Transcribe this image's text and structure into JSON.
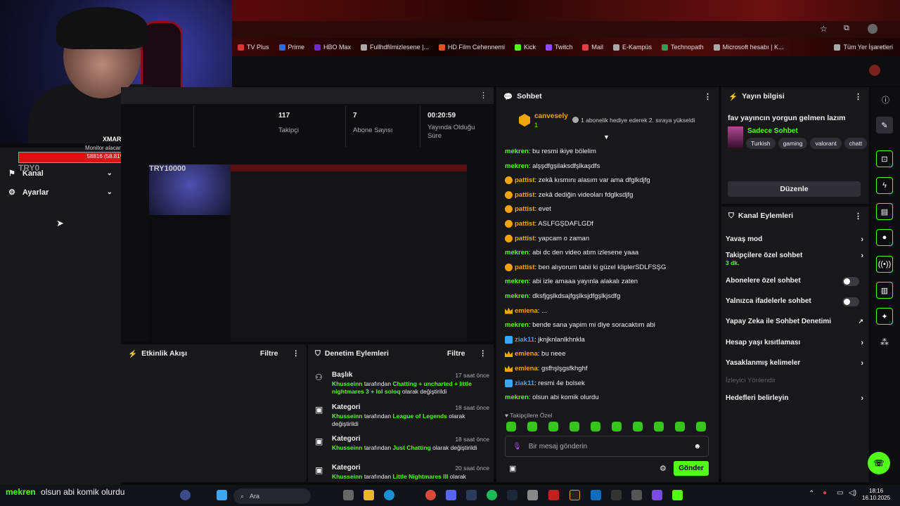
{
  "bookmarks": [
    "TV Plus",
    "Prime",
    "HBO Max",
    "Fullhdfilmizlesene |...",
    "HD Film Cehennemi",
    "Kick",
    "Twitch",
    "Mail",
    "E-Kampüs",
    "Technopath",
    "Microsoft hesabı | K...",
    "Tüm Yer İşaretleri"
  ],
  "overlay": {
    "webcam_name": "XMARD",
    "monitor_label": "Monitor alacam",
    "hp_text": "58816 (58.81%)",
    "hp_percent": 58.81
  },
  "left_nav": {
    "top_label": "TRY0",
    "items": [
      "Kanal",
      "Ayarlar"
    ]
  },
  "stats": {
    "followers": {
      "value": "117",
      "label": "Takipçi"
    },
    "subs": {
      "value": "7",
      "label": "Abone Sayısı"
    },
    "uptime": {
      "value": "00:20:59",
      "label": "Yayında Olduğu Süre"
    },
    "preview_label": "TRY10000"
  },
  "activity": {
    "title": "Etkinlik Akışı",
    "filter": "Filtre"
  },
  "modlog": {
    "title": "Denetim Eylemleri",
    "filter": "Filtre",
    "items": [
      {
        "title": "Başlık",
        "time": "17 saat önce",
        "user": "Khusseinn",
        "mid": " tarafından ",
        "value": "Chatting + uncharted + little nightmares 3 + lol soloq",
        "end": " olarak değiştirildi"
      },
      {
        "title": "Kategori",
        "time": "18 saat önce",
        "user": "Khusseinn",
        "mid": " tarafından ",
        "value": "League of Legends",
        "end": " olarak değiştirildi"
      },
      {
        "title": "Kategori",
        "time": "18 saat önce",
        "user": "Khusseinn",
        "mid": " tarafından ",
        "value": "Just Chatting",
        "end": " olarak değiştirildi"
      },
      {
        "title": "Kategori",
        "time": "20 saat önce",
        "user": "Khusseinn",
        "mid": " tarafından ",
        "value": "Little Nightmares III",
        "end": " olarak"
      }
    ]
  },
  "chat": {
    "title": "Sohbet",
    "pinned": {
      "user": "canvesely",
      "count": "1",
      "text": "1 abonelik hediye ederek 2. sıraya yükseldi"
    },
    "messages": [
      {
        "user": "mekren",
        "text": "bu resmi ikiye bölelim",
        "badge": "",
        "color": "#53fc18"
      },
      {
        "user": "mekren",
        "text": "alşşdfgşilaksdfşlkaşdfs",
        "badge": "",
        "color": "#53fc18"
      },
      {
        "user": "pattist",
        "text": "zekâ kısmını alasım var ama dfglkdjfg",
        "badge": "gold",
        "color": "#f2a40f"
      },
      {
        "user": "pattist",
        "text": "zekâ dediğin videoları fdglksdjfg",
        "badge": "gold",
        "color": "#f2a40f"
      },
      {
        "user": "pattist",
        "text": "evet",
        "badge": "gold",
        "color": "#f2a40f"
      },
      {
        "user": "pattist",
        "text": "ASLFGŞDAFLGDf",
        "badge": "gold",
        "color": "#f2a40f"
      },
      {
        "user": "pattist",
        "text": "yapcam o zaman",
        "badge": "gold",
        "color": "#f2a40f"
      },
      {
        "user": "mekren",
        "text": "abi dc den video atım izlesene yaaa",
        "badge": "",
        "color": "#53fc18"
      },
      {
        "user": "pattist",
        "text": "ben alıyorum tabii ki güzel kliplerSDLFSŞG",
        "badge": "gold",
        "color": "#f2a40f"
      },
      {
        "user": "mekren",
        "text": "abi izle amaaa yayınla alakalı zaten",
        "badge": "",
        "color": "#53fc18"
      },
      {
        "user": "mekren",
        "text": "dksfjgşlkdsajfgşlksjdfgşlkjsdfg",
        "badge": "",
        "color": "#53fc18"
      },
      {
        "user": "emiena",
        "text": "...",
        "badge": "crown",
        "color": "#f2a40f"
      },
      {
        "user": "mekren",
        "text": "bende sana yapim mi diye soracaktım abi",
        "badge": "",
        "color": "#53fc18"
      },
      {
        "user": "ziak11",
        "text": "jknjknlanlkhnkla",
        "badge": "blue",
        "color": "#3aa6f5"
      },
      {
        "user": "emiena",
        "text": "bu neee",
        "badge": "crown",
        "color": "#f2a40f"
      },
      {
        "user": "emiena",
        "text": "gsfhşlşgsfkhghf",
        "badge": "crown",
        "color": "#f2a40f"
      },
      {
        "user": "ziak11",
        "text": "resmi 4e bolsek",
        "badge": "blue",
        "color": "#3aa6f5"
      },
      {
        "user": "mekren",
        "text": "olsun abi komik olurdu",
        "badge": "",
        "color": "#53fc18"
      }
    ],
    "followers_only": "Takipçilere Özel",
    "input_placeholder": "Bir mesaj gönderin",
    "send": "Gönder"
  },
  "stream_info": {
    "title": "Yayın bilgisi",
    "stream_title": "fav yayıncın yorgun gelmen lazım",
    "category": "Sadece Sohbet",
    "tags": [
      "Turkish",
      "gaming",
      "valorant",
      "chatt"
    ],
    "edit": "Düzenle"
  },
  "channel_actions": {
    "title": "Kanal Eylemleri",
    "items": [
      {
        "label": "Yavaş mod",
        "kind": "chev"
      },
      {
        "label": "Takipçilere özel sohbet",
        "sub": "3 dk.",
        "kind": "chev"
      },
      {
        "label": "Abonelere özel sohbet",
        "kind": "toggle"
      },
      {
        "label": "Yalnızca ifadelerle sohbet",
        "kind": "toggle"
      },
      {
        "label": "Yapay Zeka ile Sohbet Denetimi",
        "kind": "ext"
      },
      {
        "label": "Hesap yaşı kısıtlaması",
        "kind": "chev"
      },
      {
        "label": "Yasaklanmış kelimeler",
        "kind": "chev"
      }
    ],
    "section_label": "İzleyici Yönlendir",
    "target": "Hedefleri belirleyin"
  },
  "taskbar": {
    "message_user": "mekren",
    "message_text": "olsun abi komik olurdu",
    "search": "Ara",
    "time": "18:16",
    "date": "16.10.2025"
  },
  "colors": {
    "accent": "#53fc18",
    "panel": "#18181b",
    "bg": "#0e0e10"
  }
}
